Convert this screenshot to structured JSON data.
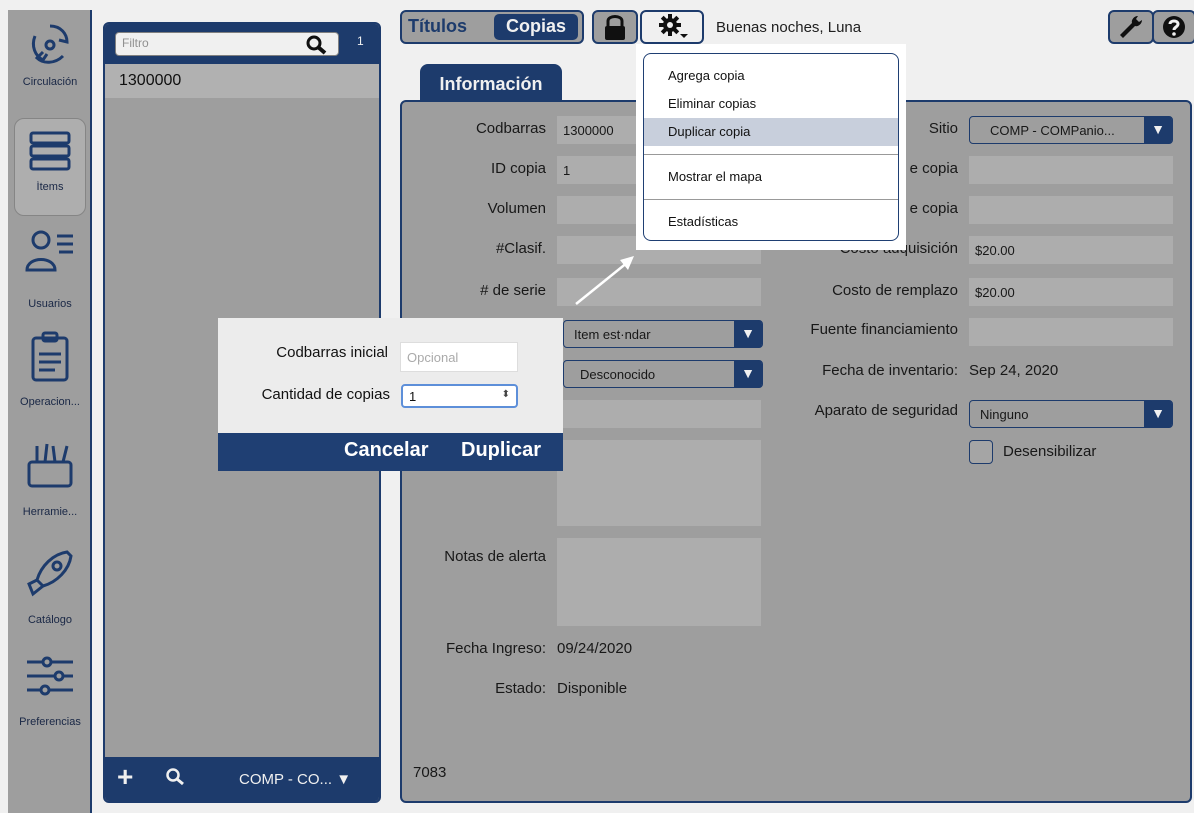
{
  "rail": {
    "items": [
      {
        "label": "Circulación",
        "icon": "circulation-icon"
      },
      {
        "label": "Ítems",
        "icon": "books-icon"
      },
      {
        "label": "Usuarios",
        "icon": "users-icon"
      },
      {
        "label": "Operacion...",
        "icon": "clipboard-icon"
      },
      {
        "label": "Herramie...",
        "icon": "tools-icon"
      },
      {
        "label": "Catálogo",
        "icon": "rocket-icon"
      },
      {
        "label": "Preferencias",
        "icon": "sliders-icon"
      }
    ]
  },
  "list": {
    "filter_placeholder": "Filtro",
    "count": "1",
    "rows": [
      "1300000"
    ],
    "site_select": "COMP - CO..."
  },
  "tabs": {
    "titulos": "Títulos",
    "copias": "Copias"
  },
  "greeting": "Buenas noches, Luna",
  "info_tab": "Información",
  "fields": {
    "codbarras_label": "Codbarras",
    "codbarras_value": "1300000",
    "id_copia_label": "ID copia",
    "id_copia_value": "1",
    "volumen_label": "Volumen",
    "clasif_label": "#Clasif.",
    "serie_label": "# de serie",
    "tipo_item_value": "Item est·ndar",
    "estado_copia_value": "Desconocido",
    "notas_alerta_label": "Notas de alerta",
    "fecha_ingreso_label": "Fecha Ingreso:",
    "fecha_ingreso_value": "09/24/2020",
    "estado_label": "Estado:",
    "estado_value": "Disponible",
    "footer_id": "7083",
    "sitio_label": "Sitio",
    "sitio_value": "COMP - COMPanio...",
    "copia_label_1": "e copia",
    "copia_label_2": "e copia",
    "costo_adq_label": "Costo adquisición",
    "costo_adq_value": "$20.00",
    "costo_rem_label": "Costo de remplazo",
    "costo_rem_value": "$20.00",
    "fuente_label": "Fuente financiamiento",
    "fecha_inv_label": "Fecha de inventario:",
    "fecha_inv_value": "Sep 24, 2020",
    "aparato_label": "Aparato de seguridad",
    "aparato_value": "Ninguno",
    "desensibilizar_label": "Desensibilizar"
  },
  "gear_menu": {
    "items": [
      "Agrega copia",
      "Eliminar copias",
      "Duplicar copia",
      "Mostrar el mapa",
      "Estadísticas"
    ],
    "highlighted": "Duplicar copia"
  },
  "dup_dialog": {
    "start_label": "Codbarras inicial",
    "start_placeholder": "Opcional",
    "qty_label": "Cantidad de copias",
    "qty_value": "1",
    "cancel": "Cancelar",
    "duplicate": "Duplicar"
  },
  "colors": {
    "navy": "#1f3f73",
    "panel_gray": "#a8a8a8",
    "highlight": "#c8cfdc"
  }
}
